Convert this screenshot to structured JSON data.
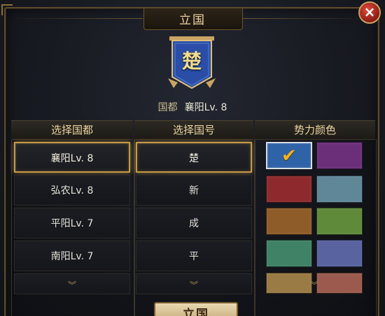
{
  "dialog": {
    "title": "立国",
    "close_label": "×"
  },
  "banner": {
    "character": "楚",
    "color": "#2a4ea8"
  },
  "capital": {
    "label": "国都",
    "value": "襄阳Lv. 8"
  },
  "columns": {
    "capital_header": "选择国都",
    "name_header": "选择国号",
    "color_header": "势力颜色"
  },
  "capitals": [
    {
      "label": "襄阳Lv. 8",
      "selected": true
    },
    {
      "label": "弘农Lv. 8",
      "selected": false
    },
    {
      "label": "平阳Lv. 7",
      "selected": false
    },
    {
      "label": "南阳Lv. 7",
      "selected": false
    }
  ],
  "names": [
    {
      "label": "楚",
      "selected": true
    },
    {
      "label": "新",
      "selected": false
    },
    {
      "label": "成",
      "selected": false
    },
    {
      "label": "平",
      "selected": false
    }
  ],
  "more_indicator": "︾",
  "colors": [
    {
      "hex": "#2f63a8",
      "selected": true
    },
    {
      "hex": "#6b2f7a",
      "selected": false
    },
    {
      "hex": "#8e2a2e",
      "selected": false
    },
    {
      "hex": "#5f8797",
      "selected": false
    },
    {
      "hex": "#8e5c28",
      "selected": false
    },
    {
      "hex": "#5e8a3a",
      "selected": false
    },
    {
      "hex": "#3f8265",
      "selected": false
    },
    {
      "hex": "#5863a0",
      "selected": false
    },
    {
      "hex": "#9a7a45",
      "selected": false
    },
    {
      "hex": "#9b5a4d",
      "selected": false
    }
  ],
  "check_mark": "✔",
  "confirm_label": "立国"
}
